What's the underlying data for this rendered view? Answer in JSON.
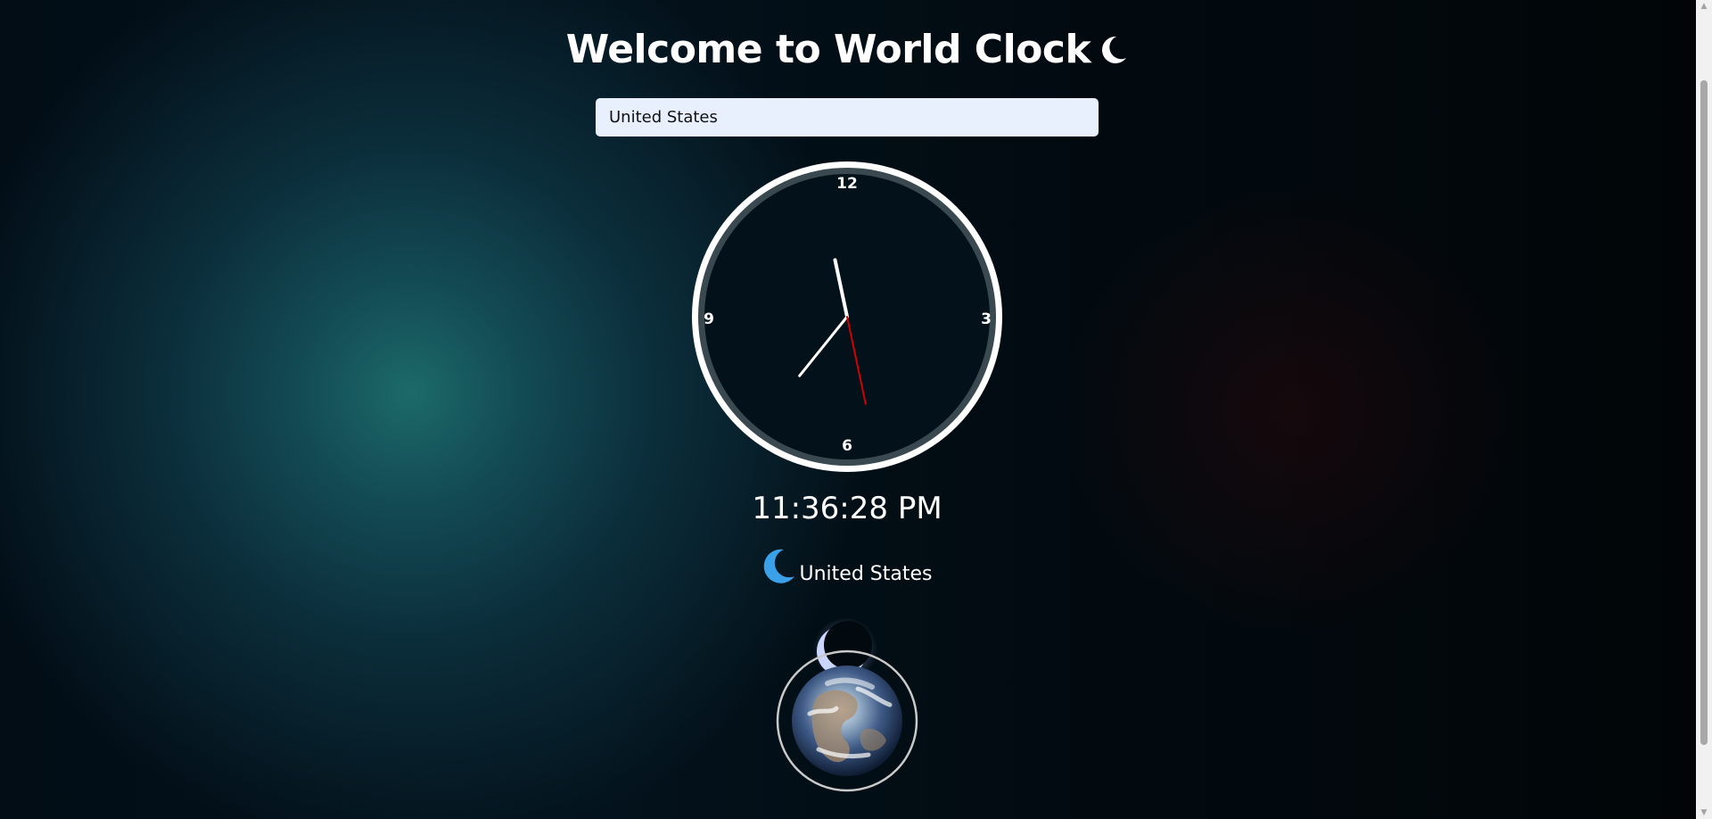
{
  "header": {
    "title": "Welcome to World Clock",
    "title_icon": "crescent-moon-icon"
  },
  "search": {
    "value": "United States"
  },
  "clock": {
    "numerals": {
      "top": "12",
      "right": "3",
      "bottom": "6",
      "left": "9"
    },
    "time": {
      "hours": 23,
      "minutes": 36,
      "seconds": 28
    },
    "colors": {
      "hour_hand": "#ffffff",
      "minute_hand": "#ffffff",
      "second_hand": "#d40000",
      "rim": "#ffffff",
      "face": "#03111a"
    }
  },
  "display": {
    "time": "11:36:28 PM",
    "location": "United States",
    "location_icon": "crescent-moon-icon"
  },
  "illustration": {
    "moon_icon": "crescent-moon-icon",
    "earth_icon": "earth-globe-icon"
  },
  "colors": {
    "accent_moon": "#3aa0e8",
    "background_glow": "#1c6a69"
  }
}
